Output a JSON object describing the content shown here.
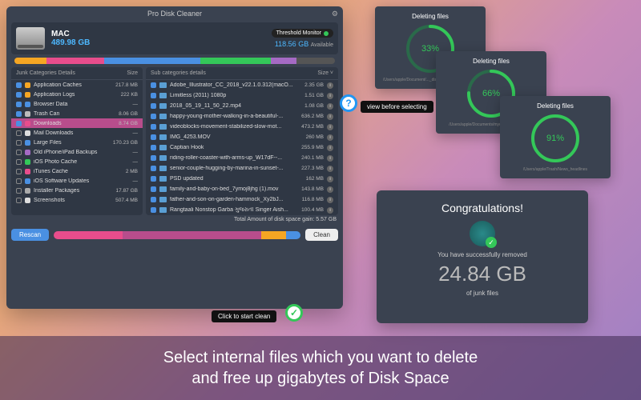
{
  "app": {
    "title": "Pro Disk Cleaner"
  },
  "disk": {
    "name": "MAC",
    "used": "489.98 GB",
    "available": "118.56 GB",
    "avail_label": "Available",
    "threshold": "Threshold Monitor"
  },
  "left": {
    "header": "Junk Categories Details",
    "size_header": "Size",
    "rows": [
      {
        "c": "#f5a623",
        "n": "Application Caches",
        "s": "217.8 MB",
        "on": true
      },
      {
        "c": "#f5a623",
        "n": "Application Logs",
        "s": "222 KB",
        "on": true
      },
      {
        "c": "#4a90e2",
        "n": "Browser Data",
        "s": "—",
        "on": true
      },
      {
        "c": "#bbb",
        "n": "Trash Can",
        "s": "8.06 GB",
        "on": true
      },
      {
        "c": "#e84d8c",
        "n": "Downloads",
        "s": "8.74 GB",
        "on": true,
        "sel": true
      },
      {
        "c": "#ddd",
        "n": "Mail Downloads",
        "s": "—",
        "on": false
      },
      {
        "c": "#4a90e2",
        "n": "Large Files",
        "s": "170.23 GB",
        "on": false
      },
      {
        "c": "#a56ac4",
        "n": "Old iPhone/iPad Backups",
        "s": "—",
        "on": false
      },
      {
        "c": "#34c759",
        "n": "iOS Photo Cache",
        "s": "—",
        "on": false
      },
      {
        "c": "#e84d8c",
        "n": "iTunes Cache",
        "s": "2 MB",
        "on": false
      },
      {
        "c": "#4a90e2",
        "n": "iOS Software Updates",
        "s": "—",
        "on": false
      },
      {
        "c": "#aaa",
        "n": "Installer Packages",
        "s": "17.87 GB",
        "on": false
      },
      {
        "c": "#ddd",
        "n": "Screenshots",
        "s": "507.4 MB",
        "on": false
      }
    ]
  },
  "right": {
    "header": "Sub categories details",
    "size_header": "Size ˅",
    "rows": [
      {
        "n": "Adobe_Illustrator_CC_2018_v22.1.0.312(macO...",
        "s": "2.35 GB"
      },
      {
        "n": "Limitless (2011) 1080p",
        "s": "1.51 GB"
      },
      {
        "n": "2018_05_19_11_50_22.mp4",
        "s": "1.08 GB"
      },
      {
        "n": "happy-young-mother-walking-in-a-beautiful-...",
        "s": "636.2 MB"
      },
      {
        "n": "videoblocks-movement-stabilized-slow-mot...",
        "s": "473.2 MB"
      },
      {
        "n": "IMG_4253.MOV",
        "s": "260 MB"
      },
      {
        "n": "Captian Hook",
        "s": "255.9 MB"
      },
      {
        "n": "riding-roller-coaster-with-arms-up_W17dF--...",
        "s": "240.1 MB"
      },
      {
        "n": "senior-couple-hugging-by-marina-in-sunset-...",
        "s": "227.3 MB"
      },
      {
        "n": "PSD updated",
        "s": "162 MB"
      },
      {
        "n": "family-and-baby-on-bed_7ymoj8jhg (1).mov",
        "s": "143.8 MB"
      },
      {
        "n": "father-and-son-on-garden-hammock_Xy2bJ...",
        "s": "116.8 MB"
      },
      {
        "n": "Rangtaali Nonstop Garba ગુજરાતી Singer Aish...",
        "s": "100.4 MB"
      }
    ]
  },
  "footer": {
    "rescan": "Rescan",
    "clean": "Clean",
    "total": "Total Amount of disk space gain: 5.57 GB"
  },
  "callouts": {
    "view": "view before selecting",
    "start": "Click to start clean"
  },
  "progress": [
    {
      "title": "Deleting files",
      "pct": 33,
      "path": "/Users/apple/Document/..._disk/finpin/SIMO7526.MOV"
    },
    {
      "title": "Deleting files",
      "pct": 66,
      "path": "/Users/apple/Documents/mydrive/disk/VV1.mov"
    },
    {
      "title": "Deleting files",
      "pct": 91,
      "path": "/Users/apple/Trash/News_headlines"
    }
  ],
  "congrats": {
    "title": "Congratulations!",
    "sub": "You have successfully removed",
    "value": "24.84 GB",
    "foot": "of junk files"
  },
  "tagline": {
    "l1": "Select internal files which you want to delete",
    "l2": "and free up gigabytes of Disk Space"
  }
}
